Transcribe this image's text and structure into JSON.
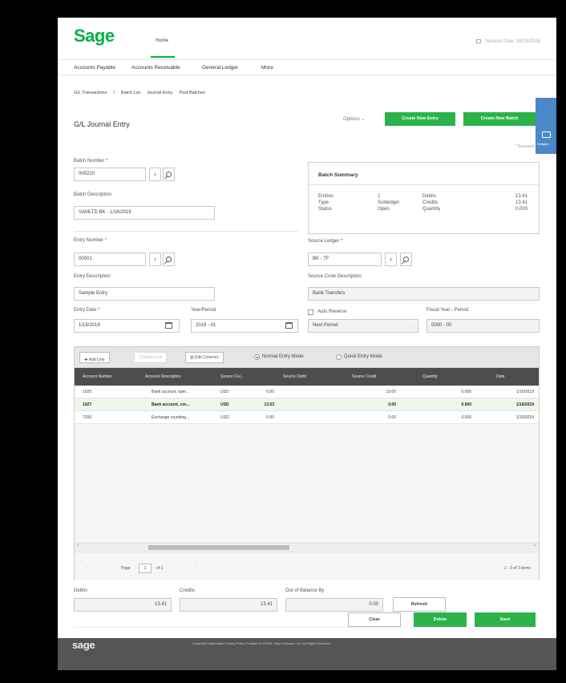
{
  "header": {
    "logo": "Sage",
    "home_tab": "Home",
    "session": "Session Date: 08/23/2018"
  },
  "menu": [
    "Accounts Payable",
    "Accounts Receivable",
    "General Ledger",
    "More"
  ],
  "breadcrumb": [
    "G/L Transactions",
    "/",
    "Batch List",
    "Journal Entry",
    "Post Batches"
  ],
  "page": {
    "title": "G/L Journal Entry",
    "options": "Options",
    "create_entry": "Create New Entry",
    "create_batch": "Create New Batch",
    "side_tab": "Widgets",
    "required_note": "* Required"
  },
  "batch": {
    "number_label": "Batch Number *",
    "number": "000220",
    "desc_label": "Batch Description",
    "desc": "SAMLTD BK - 1/16/2019"
  },
  "summary": {
    "title": "Batch Summary",
    "entries_label": "Entries",
    "entries": "1",
    "type_label": "Type",
    "type": "Subledger",
    "status_label": "Status",
    "status": "Open",
    "debits_label": "Debits",
    "debits": "13.41",
    "credits_label": "Credits",
    "credits": "13.41",
    "quantity_label": "Quantity",
    "quantity": "0.000"
  },
  "entry": {
    "number_label": "Entry Number *",
    "number": "00001",
    "desc_label": "Entry Description",
    "desc": "Sample Entry",
    "date_label": "Entry Date *",
    "date": "1/16/2019",
    "year_period_label": "Year/Period",
    "year_period": "2019 - 01",
    "source_ledger_label": "Source Ledger *",
    "source_ledger": "BK - TF",
    "source_desc_label": "Source Code Description",
    "source_desc": "Bank Transfers",
    "auto_reverse_label": "Auto Reverse",
    "reverse_to": "Next Period",
    "fiscal_label": "Fiscal Year - Period",
    "fiscal": "0000 - 00"
  },
  "grid": {
    "add_line": "Add Line",
    "delete_line": "Delete Line",
    "edit_columns": "Edit Columns",
    "normal_mode": "Normal Entry Mode",
    "quick_mode": "Quick Entry Mode",
    "columns": [
      "Account Number",
      "Account Description",
      "Source Cur...",
      "Source Debit",
      "Source Credit",
      "Quantity",
      "Date"
    ],
    "rows": [
      [
        "1020",
        "Bank account, oper...",
        "USD",
        "0.00",
        "13.00",
        "0.000",
        "1/16/2019"
      ],
      [
        "1027",
        "Bank account, cor...",
        "USD",
        "13.03",
        "0.00",
        "0.000",
        "1/16/2019"
      ],
      [
        "7200",
        "Exchange rounding...",
        "USD",
        "0.00",
        "0.00",
        "0.000",
        "1/16/2019"
      ]
    ],
    "page_label": "Page",
    "page": "1",
    "of": "of 1",
    "items": "1 - 3 of 3 items"
  },
  "totals": {
    "debits_label": "Debits",
    "debits": "13.41",
    "credits_label": "Credits",
    "credits": "13.41",
    "oob_label": "Out of Balance By",
    "oob": "0.00",
    "refresh": "Refresh"
  },
  "actions": {
    "clear": "Clear",
    "delete": "Delete",
    "save": "Save"
  },
  "footer": {
    "logo": "sage",
    "text": "Copyright/Trademarks    Privacy Policy    Contact Us    ©2019, Sage Software, Inc. All Rights Reserved"
  },
  "colors": {
    "brand_green": "#00b140",
    "button_green": "#2bb34a",
    "grid_header": "#4d4d4d",
    "side_tab": "#4b88c7"
  }
}
